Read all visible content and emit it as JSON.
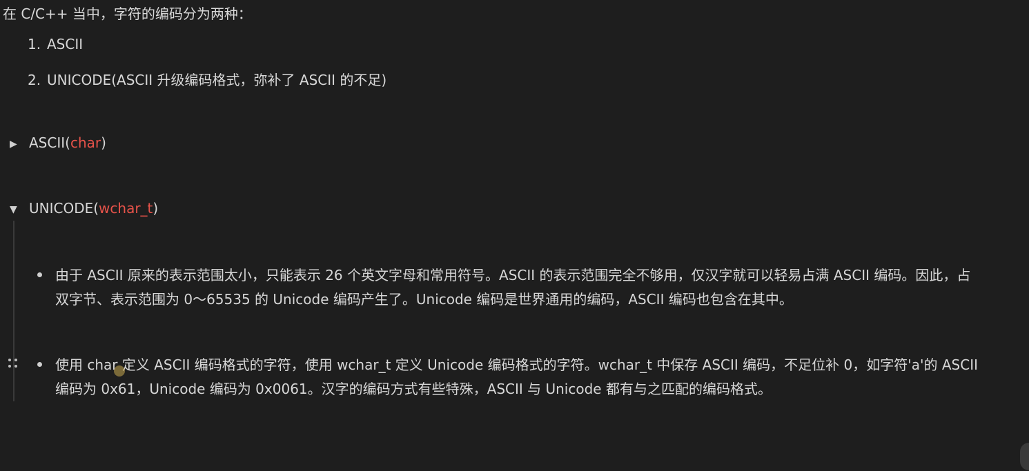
{
  "intro": "在 C/C++ 当中，字符的编码分为两种：",
  "ordered_list": [
    {
      "num": "1.",
      "text": "ASCII"
    },
    {
      "num": "2.",
      "text": "UNICODE(ASCII 升级编码格式，弥补了 ASCII 的不足)"
    }
  ],
  "toggles": {
    "ascii": {
      "icon": "triangle-right-icon",
      "glyph": "▶",
      "prefix": "ASCII(",
      "code": "char",
      "suffix": ")"
    },
    "unicode": {
      "icon": "triangle-down-icon",
      "glyph": "▼",
      "prefix": "UNICODE(",
      "code": "wchar_t",
      "suffix": ")"
    }
  },
  "bullets": [
    "由于 ASCII 原来的表示范围太小，只能表示 26 个英文字母和常用符号。ASCII 的表示范围完全不够用，仅汉字就可以轻易占满 ASCII 编码。因此，占双字节、表示范围为 0～65535 的 Unicode 编码产生了。Unicode 编码是世界通用的编码，ASCII 编码也包含在其中。",
    "使用 char 定义 ASCII 编码格式的字符，使用 wchar_t 定义 Unicode 编码格式的字符。wchar_t 中保存 ASCII 编码，不足位补 0，如字符'a'的 ASCII 编码为 0x61，Unicode 编码为 0x0061。汉字的编码方式有些特殊，ASCII 与 Unicode 都有与之匹配的编码格式。"
  ],
  "colors": {
    "background": "#1e1e1e",
    "text": "#d7d7d7",
    "code_accent": "#e8534a"
  }
}
